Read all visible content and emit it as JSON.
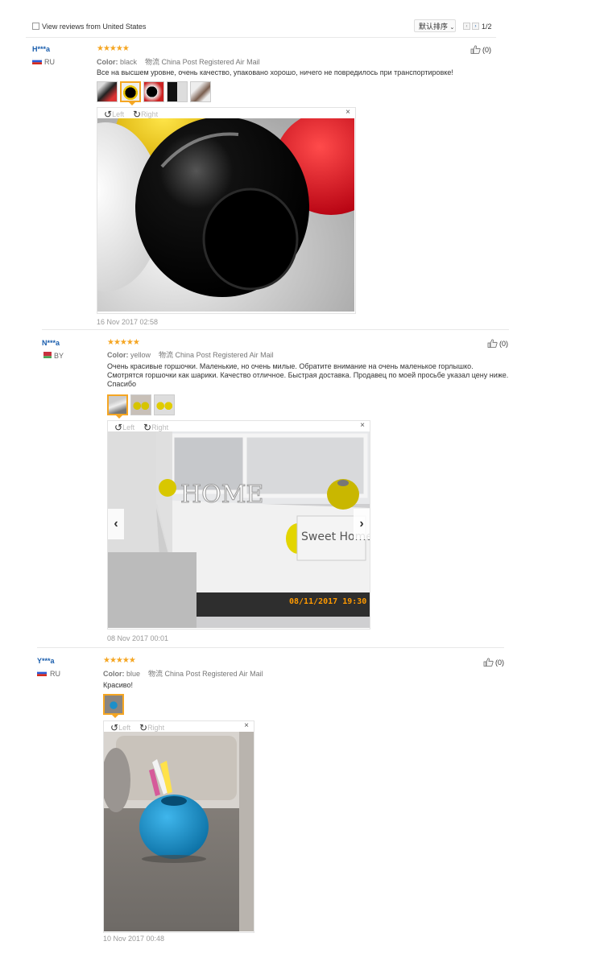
{
  "toolbar": {
    "filter_label": "View reviews from United States",
    "sort_label": "默认排序",
    "prev": "‹",
    "next": "›",
    "page": "1/2"
  },
  "labels": {
    "color": "Color:",
    "likes": "(0)",
    "left": "Left",
    "right": "Right"
  },
  "reviews": [
    {
      "user": "H***a",
      "country": "RU",
      "stars": "★★★★★",
      "color": "black",
      "shipping": "物流 China Post Registered Air Mail",
      "text": "Все на высшем уровне, очень качество, упаковано хорошо, ничего не повредилось при транспортировке!",
      "date": "16 Nov 2017 02:58"
    },
    {
      "user": "N***a",
      "country": "BY",
      "stars": "★★★★★",
      "color": "yellow",
      "shipping": "物流 China Post Registered Air Mail",
      "text": "Очень красивые горшочки. Маленькие, но очень милые. Обратите внимание на очень маленькое горлышко. Смотрятся горшочки как шарики. Качество отличное. Быстрая доставка. Продавец по моей просьбе указал цену ниже. Спасибо",
      "date": "08 Nov 2017 00:01",
      "photo_text": {
        "home": "HOME",
        "sweet_home": "Sweet Home",
        "timestamp": "08/11/2017 19:30"
      }
    },
    {
      "user": "Y***a",
      "country": "RU",
      "stars": "★★★★★",
      "color": "blue",
      "shipping": "物流 China Post Registered Air Mail",
      "text": "Красиво!",
      "date": "10 Nov 2017 00:48"
    }
  ],
  "colors": {
    "link": "#1a5ead",
    "star": "#f5a623",
    "selected_border": "#f5a623"
  }
}
